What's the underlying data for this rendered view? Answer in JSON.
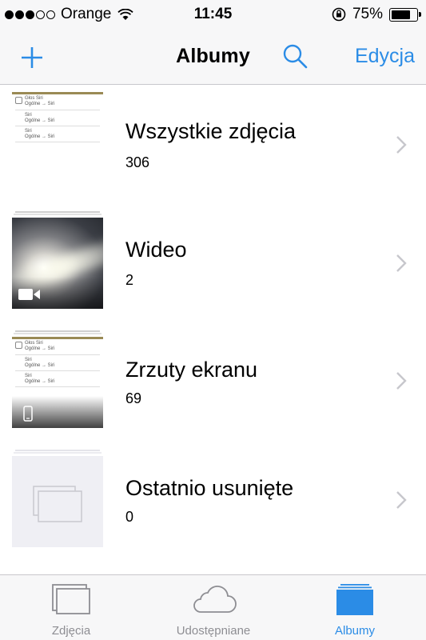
{
  "status_bar": {
    "carrier": "Orange",
    "time": "11:45",
    "battery_percent": "75%",
    "battery_level": 0.75,
    "signal_bars_filled": 3,
    "signal_bars_total": 5
  },
  "nav": {
    "title": "Albumy",
    "edit_label": "Edycja",
    "add_icon": "plus-icon",
    "search_icon": "search-icon"
  },
  "albums": [
    {
      "name": "Wszystkie zdjęcia",
      "count": "306",
      "thumb": "screenshot"
    },
    {
      "name": "Wideo",
      "count": "2",
      "thumb": "video"
    },
    {
      "name": "Zrzuty ekranu",
      "count": "69",
      "thumb": "screenshot-dark"
    },
    {
      "name": "Ostatnio usunięte",
      "count": "0",
      "thumb": "empty"
    }
  ],
  "thumb_text": {
    "line1": "Głos Siri",
    "line1_sub": "Ogólne → Siri",
    "line2": "Siri",
    "line2_sub": "Ogólne → Siri",
    "line3": "Siri",
    "line3_sub": "Ogólne → Siri"
  },
  "tabs": [
    {
      "label": "Zdjęcia",
      "icon": "photos-icon",
      "active": false
    },
    {
      "label": "Udostępniane",
      "icon": "cloud-icon",
      "active": false
    },
    {
      "label": "Albumy",
      "icon": "albums-icon",
      "active": true
    }
  ],
  "colors": {
    "accent": "#2b8ce6",
    "inactive": "#8e8e93",
    "bar_bg": "#f7f7f8"
  }
}
